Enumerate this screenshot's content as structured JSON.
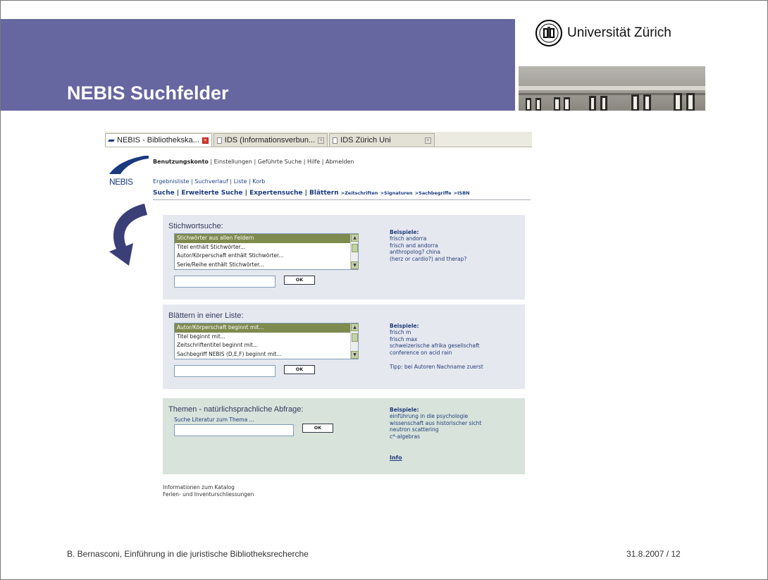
{
  "slide": {
    "title": "NEBIS Suchfelder",
    "university": "Universität Zürich",
    "footer_author": "B. Bernasconi, Einführung in die juristische Bibliotheksrecherche",
    "footer_page": "31.8.2007  /  12"
  },
  "colors": {
    "band": "#6666a0",
    "panel": "#e5e8ef",
    "panel_green": "#d8e3dc",
    "link": "#223c7a"
  },
  "browser": {
    "tabs": [
      {
        "label": "NEBIS - Bibliothekskа...",
        "icon": "nebis-favicon-icon"
      },
      {
        "label": "IDS (Informationsverbun...",
        "icon": "page-icon"
      },
      {
        "label": "IDS Zürich Uni",
        "icon": "page-icon"
      }
    ]
  },
  "nebis": {
    "logo_text": "NEBIS",
    "topnav": [
      "Benutzungskonto",
      "Einstellungen",
      "Geführte Suche",
      "Hilfe",
      "Abmelden"
    ],
    "subnav": [
      "Ergebnisliste",
      "Suchverlauf",
      "Liste",
      "Korb"
    ],
    "mainnav": [
      "Suche",
      "Erweiterte Suche",
      "Expertensuche",
      "Blättern"
    ],
    "mainnav_small": [
      ">Zeitschriften",
      ">Signaturen",
      ">Sachbegriffe",
      ">ISBN"
    ]
  },
  "stichwort": {
    "title": "Stichwortsuche:",
    "options": [
      "Stichwörter aus allen Feldern",
      "Titel enthält Stichwörter...",
      "Autor/Körperschaft enthält Stichwörter...",
      "Serie/Reihe enthält Stichwörter..."
    ],
    "ok": "OK",
    "examples_title": "Beispiele:",
    "examples": [
      "frisch andorra",
      "frisch and andorra",
      "anthropolog? china",
      "(herz or cardio?) and therap?"
    ]
  },
  "blaettern": {
    "title": "Blättern in einer Liste:",
    "options": [
      "Autor/Körperschaft beginnt mit...",
      "Titel beginnt mit...",
      "Zeitschriftentitel beginnt mit...",
      "Sachbegriff NEBIS (D,E,F) beginnt mit..."
    ],
    "ok": "OK",
    "examples_title": "Beispiele:",
    "examples": [
      "frisch m",
      "frisch max",
      "schweizerische afrika gesellschaft",
      "conference on acid rain"
    ],
    "tip": "Tipp: bei Autoren Nachname zuerst"
  },
  "themen": {
    "title": "Themen - natürlichsprachliche Abfrage:",
    "label": "Suche Literatur zum Thema ...",
    "ok": "OK",
    "examples_title": "Beispiele:",
    "examples": [
      "einführung in die psychologie",
      "wissenschaft aus historischer sicht",
      "neutron scattering",
      "c*-algebras"
    ],
    "info": "Info"
  },
  "footer_links": [
    "Informationen zum Katalog",
    "Ferien- und Inventurschliessungen"
  ]
}
